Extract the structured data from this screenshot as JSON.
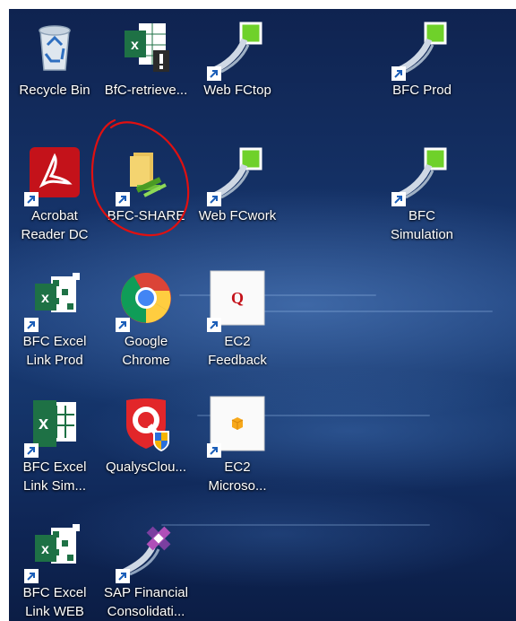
{
  "desktop": {
    "icons": [
      {
        "label": "Recycle Bin",
        "icon": "recycle-bin-icon"
      },
      {
        "label": "BfC-retrieve...",
        "icon": "excel-warning-icon"
      },
      {
        "label": "Web FCtop",
        "icon": "bfc-web-icon"
      },
      {
        "label": "BFC Prod",
        "icon": "bfc-web-icon"
      },
      {
        "label": "Acrobat\nReader DC",
        "icon": "acrobat-icon"
      },
      {
        "label": "BFC-SHARE",
        "icon": "network-folder-icon"
      },
      {
        "label": "Web FCwork",
        "icon": "bfc-web-icon"
      },
      {
        "label": "BFC\nSimulation",
        "icon": "bfc-web-icon"
      },
      {
        "label": "BFC Excel\nLink Prod",
        "icon": "excel-grid-icon"
      },
      {
        "label": "Google\nChrome",
        "icon": "chrome-icon"
      },
      {
        "label": "EC2\nFeedback",
        "icon": "ec2-feedback-icon"
      },
      {
        "label": "BFC Excel\nLink Sim...",
        "icon": "excel-icon"
      },
      {
        "label": "QualysClou...",
        "icon": "qualys-icon"
      },
      {
        "label": "EC2\nMicroso...",
        "icon": "ec2-box-icon"
      },
      {
        "label": "BFC Excel\nLink WEB",
        "icon": "excel-grid-icon"
      },
      {
        "label": "SAP Financial\nConsolidati...",
        "icon": "sap-fc-icon"
      }
    ]
  },
  "colors": {
    "annotation": "#e01010",
    "bfc_green": "#6fd12a",
    "excel_green": "#1e7145",
    "acrobat_red": "#c4121a"
  },
  "glyph_text": {
    "excel_x": "x",
    "qmark": "Q"
  }
}
